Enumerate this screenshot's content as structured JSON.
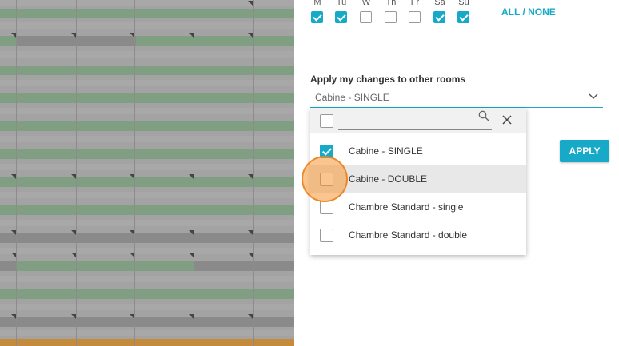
{
  "days": [
    {
      "label": "M",
      "checked": true
    },
    {
      "label": "Tu",
      "checked": true
    },
    {
      "label": "W",
      "checked": false
    },
    {
      "label": "Th",
      "checked": false
    },
    {
      "label": "Fr",
      "checked": false
    },
    {
      "label": "Sa",
      "checked": true
    },
    {
      "label": "Su",
      "checked": true
    }
  ],
  "all_none_label": "ALL / NONE",
  "apply_label": "Apply my changes to other rooms",
  "room_select": {
    "value": "Cabine - SINGLE"
  },
  "apply_button": "APPLY",
  "dropdown": {
    "search_value": "",
    "options": [
      {
        "label": "Cabine - SINGLE",
        "checked": true
      },
      {
        "label": "Cabine - DOUBLE",
        "checked": false
      },
      {
        "label": "Chambre Standard - single",
        "checked": false
      },
      {
        "label": "Chambre Standard - double",
        "checked": false
      }
    ]
  },
  "colors": {
    "accent": "#17a9c8",
    "grid_green": "#7f9e82",
    "grid_dark": "#8a8a8a",
    "grid_light": "#b5b5b5"
  }
}
